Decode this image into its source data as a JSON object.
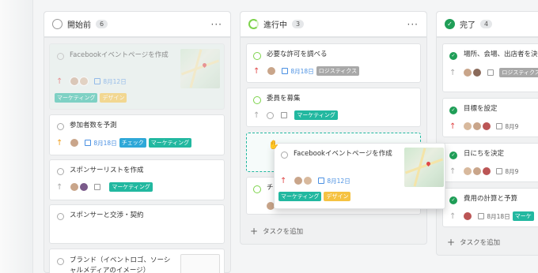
{
  "columns": [
    {
      "title": "開始前",
      "count": "6"
    },
    {
      "title": "進行中",
      "count": "3"
    },
    {
      "title": "完了",
      "count": "4"
    }
  ],
  "more_label": "···",
  "col1": {
    "card1": {
      "title": "Facebookイベントページを作成",
      "date": "8月12日",
      "tags": [
        "マーケティング",
        "デザイン"
      ]
    },
    "card2": {
      "title": "参加者数を予測",
      "date": "8月18日",
      "tags": [
        "チェック",
        "マーケティング"
      ]
    },
    "card3": {
      "title": "スポンサーリストを作成",
      "tags": [
        "マーケティング"
      ]
    },
    "card4": {
      "title": "スポンサーと交渉・契約"
    },
    "card5": {
      "title": "ブランド（イベントロゴ、ソーシャルメディアのイメージ）"
    }
  },
  "col2": {
    "card1": {
      "title": "必要な許可を調べる",
      "date": "8月18日",
      "tags": [
        "ロジスティクス"
      ]
    },
    "card2": {
      "title": "委員を募集",
      "tags": [
        "マーケティング"
      ]
    },
    "card4": {
      "title": "チ"
    },
    "add_task": "タスクを追加"
  },
  "col3": {
    "card1": {
      "title": "場所、会場、出店者を決",
      "tags": [
        "ロジスティクス"
      ]
    },
    "card2": {
      "title": "目標を設定",
      "date": "8月9"
    },
    "card3": {
      "title": "日にちを決定",
      "date": "8月9"
    },
    "card4": {
      "title": "費用の計算と予算",
      "date": "8月18日",
      "tags": [
        "マーケ"
      ]
    },
    "add_task": "タスクを追加"
  },
  "drag": {
    "title": "Facebookイベントページを作成",
    "date": "8月12日",
    "tags": [
      "マーケティング",
      "デザイン"
    ]
  },
  "icons": {
    "status": "circle-icon",
    "priority": "arrow-up-icon",
    "calendar": "calendar-icon",
    "add": "plus-icon",
    "grab": "grab-hand-icon"
  },
  "colors": {
    "teal": "#22b8a0",
    "yellow": "#f5c242",
    "gray": "#a8a8a8",
    "blue": "#2fa8d8",
    "green": "#1f9e57",
    "red": "#e04848"
  }
}
